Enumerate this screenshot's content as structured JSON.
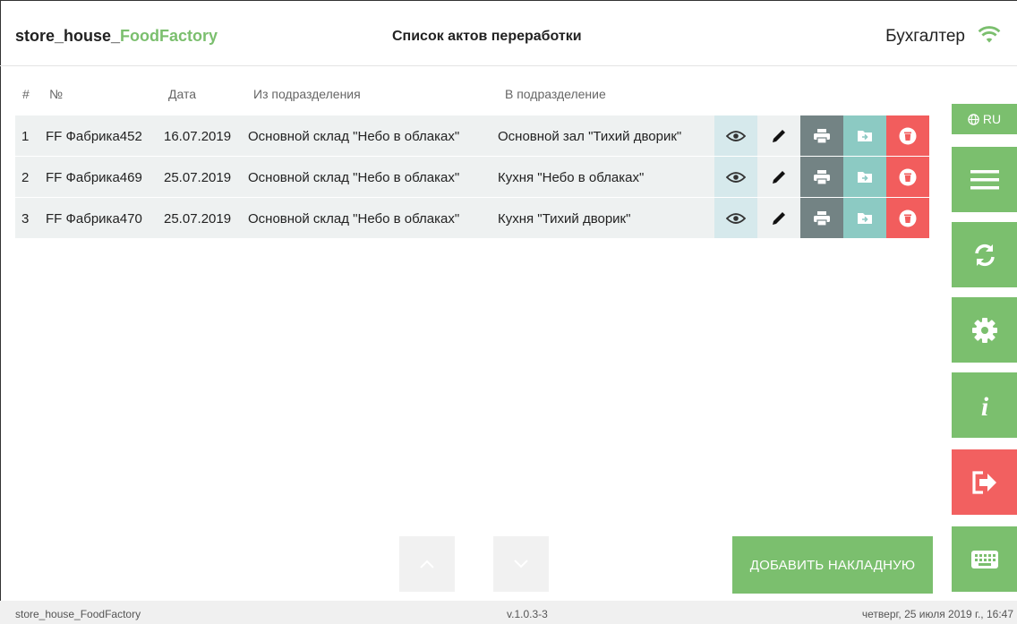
{
  "header": {
    "brand_prefix": "store_house_",
    "brand_accent": "FoodFactory",
    "title": "Список актов переработки",
    "user": "Бухгалтер",
    "wifi_icon": "wifi-icon"
  },
  "table": {
    "columns": [
      "#",
      "№",
      "Дата",
      "Из подразделения",
      "В подразделение"
    ],
    "rows": [
      {
        "idx": "1",
        "num": "FF Фабрика452",
        "date": "16.07.2019",
        "from": "Основной склад \"Небо в облаках\"",
        "to": "Основной зал \"Тихий дворик\""
      },
      {
        "idx": "2",
        "num": "FF Фабрика469",
        "date": "25.07.2019",
        "from": "Основной склад \"Небо в облаках\"",
        "to": "Кухня \"Небо в облаках\""
      },
      {
        "idx": "3",
        "num": "FF Фабрика470",
        "date": "25.07.2019",
        "from": "Основной склад \"Небо в облаках\"",
        "to": "Кухня \"Тихий дворик\""
      }
    ],
    "row_actions": [
      "eye-icon",
      "pencil-icon",
      "printer-icon",
      "folder-move-icon",
      "trash-icon"
    ]
  },
  "sidebar": {
    "lang": "RU",
    "buttons": [
      "menu-icon",
      "sync-icon",
      "gear-icon",
      "info-icon",
      "logout-icon",
      "keyboard-icon"
    ]
  },
  "actions": {
    "add_label": "ДОБАВИТЬ НАКЛАДНУЮ"
  },
  "footer": {
    "app": "store_house_FoodFactory",
    "version": "v.1.0.3-3",
    "datetime": "четверг, 25 июля 2019 г., 16:47"
  },
  "colors": {
    "accent": "#7bbf6e",
    "danger": "#f25d5d",
    "print": "#738384",
    "move": "#8ccac3",
    "view": "#d6e9ec"
  }
}
